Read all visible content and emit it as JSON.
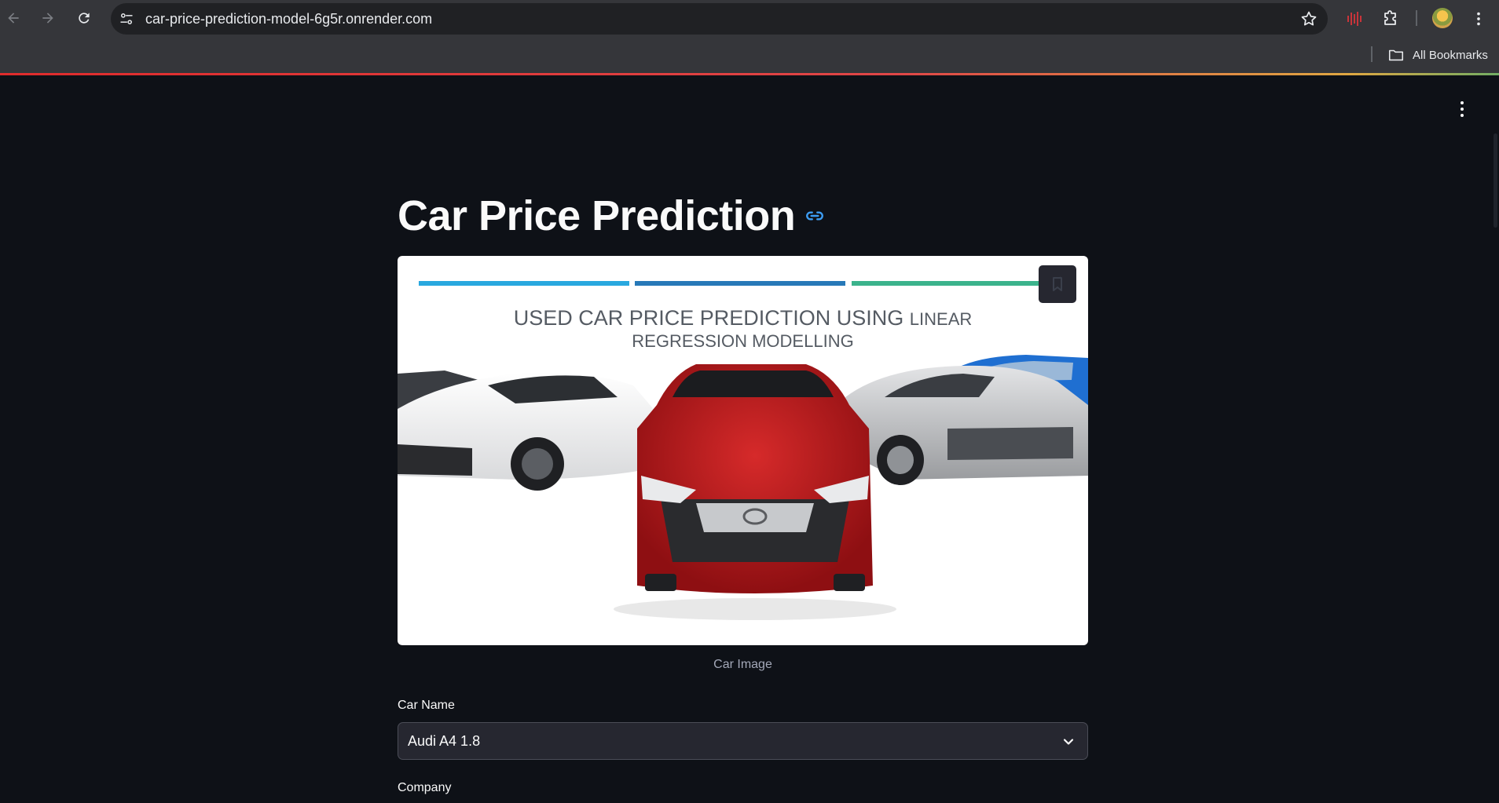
{
  "browser": {
    "url": "car-price-prediction-model-6g5r.onrender.com",
    "bookmarks_label": "All Bookmarks"
  },
  "app": {
    "title": "Car Price Prediction",
    "banner": {
      "line1_main": "USED CAR PRICE PREDICTION USING",
      "line1_small": "LINEAR",
      "line2": "REGRESSION MODELLING",
      "bar_colors": [
        "#29a8df",
        "#2779b8",
        "#3bb38c"
      ]
    },
    "image_caption": "Car Image",
    "car_name": {
      "label": "Car Name",
      "value": "Audi A4 1.8"
    },
    "company": {
      "label": "Company"
    }
  }
}
